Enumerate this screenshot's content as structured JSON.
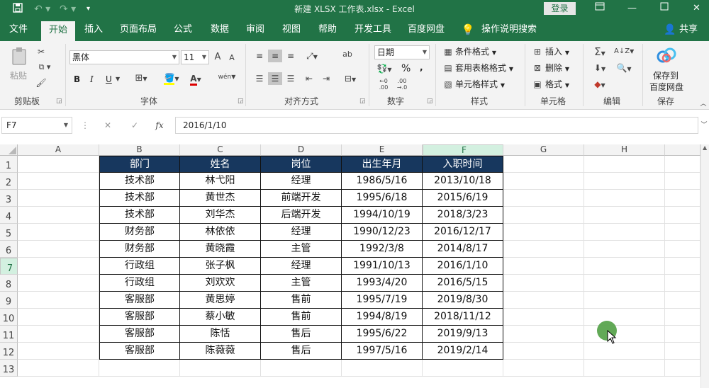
{
  "window": {
    "title": "新建 XLSX 工作表.xlsx  -  Excel",
    "login_label": "登录"
  },
  "tabs": [
    "文件",
    "开始",
    "插入",
    "页面布局",
    "公式",
    "数据",
    "审阅",
    "视图",
    "帮助",
    "开发工具",
    "百度网盘"
  ],
  "tell_me": "操作说明搜索",
  "share_label": "共享",
  "ribbon": {
    "clipboard": {
      "paste": "粘贴",
      "group": "剪贴板"
    },
    "font": {
      "name": "黑体",
      "size": "11",
      "group": "字体",
      "bold": "B",
      "italic": "I",
      "underline": "U",
      "grow": "A",
      "shrink": "A",
      "color_a": "A",
      "phonetic": "wén"
    },
    "alignment": {
      "group": "对齐方式",
      "wrap": "ab"
    },
    "number": {
      "format": "日期",
      "group": "数字",
      "percent": "%",
      "comma": ","
    },
    "styles": {
      "conditional": "条件格式",
      "table": "套用表格格式",
      "cell_styles": "单元格样式",
      "group": "样式"
    },
    "cells": {
      "insert": "插入",
      "delete": "删除",
      "format": "格式",
      "group": "单元格"
    },
    "editing": {
      "group": "编辑"
    },
    "save": {
      "label1": "保存到",
      "label2": "百度网盘",
      "group": "保存"
    }
  },
  "formula_bar": {
    "name_box": "F7",
    "fx": "fx",
    "value": "2016/1/10"
  },
  "columns": [
    "A",
    "B",
    "C",
    "D",
    "E",
    "F",
    "G",
    "H"
  ],
  "rows": [
    "1",
    "2",
    "3",
    "4",
    "5",
    "6",
    "7",
    "8",
    "9",
    "10",
    "11",
    "12",
    "13"
  ],
  "table": {
    "headers": [
      "部门",
      "姓名",
      "岗位",
      "出生年月",
      "入职时间"
    ],
    "rows": [
      [
        "技术部",
        "林弋阳",
        "经理",
        "1986/5/16",
        "2013/10/18"
      ],
      [
        "技术部",
        "黄世杰",
        "前端开发",
        "1995/6/18",
        "2015/6/19"
      ],
      [
        "技术部",
        "刘华杰",
        "后端开发",
        "1994/10/19",
        "2018/3/23"
      ],
      [
        "财务部",
        "林依依",
        "经理",
        "1990/12/23",
        "2016/12/17"
      ],
      [
        "财务部",
        "黄晓霞",
        "主管",
        "1992/3/8",
        "2014/8/17"
      ],
      [
        "行政组",
        "张子枫",
        "经理",
        "1991/10/13",
        "2016/1/10"
      ],
      [
        "行政组",
        "刘欢欢",
        "主管",
        "1993/4/20",
        "2016/5/15"
      ],
      [
        "客服部",
        "黄思婷",
        "售前",
        "1995/7/19",
        "2019/8/30"
      ],
      [
        "客服部",
        "蔡小敏",
        "售前",
        "1994/8/19",
        "2018/11/12"
      ],
      [
        "客服部",
        "陈恬",
        "售后",
        "1995/6/22",
        "2019/9/13"
      ],
      [
        "客服部",
        "陈薇薇",
        "售后",
        "1997/5/16",
        "2019/2/14"
      ]
    ]
  },
  "colors": {
    "excel_green": "#217346",
    "table_header": "#17375e"
  }
}
